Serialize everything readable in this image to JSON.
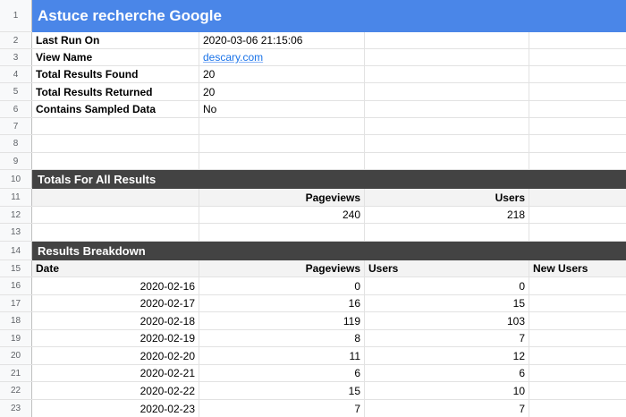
{
  "title": "Astuce recherche Google",
  "row_numbers": [
    "1",
    "2",
    "3",
    "4",
    "5",
    "6",
    "7",
    "8",
    "9",
    "10",
    "11",
    "12",
    "13",
    "14",
    "15",
    "16",
    "17",
    "18",
    "19",
    "20",
    "21",
    "22",
    "23"
  ],
  "meta": [
    {
      "label": "Last Run On",
      "value": "2020-03-06 21:15:06"
    },
    {
      "label": "View Name",
      "value": "descary.com"
    },
    {
      "label": "Total Results Found",
      "value": "20"
    },
    {
      "label": "Total Results Returned",
      "value": "20"
    },
    {
      "label": "Contains Sampled Data",
      "value": "No"
    }
  ],
  "totals": {
    "heading": "Totals For All Results",
    "col_pageviews": "Pageviews",
    "col_users": "Users",
    "pageviews": "240",
    "users": "218"
  },
  "breakdown": {
    "heading": "Results Breakdown",
    "headers": {
      "date": "Date",
      "pageviews": "Pageviews",
      "users": "Users",
      "new_users": "New Users"
    },
    "rows": [
      {
        "date": "2020-02-16",
        "pageviews": "0",
        "users": "0"
      },
      {
        "date": "2020-02-17",
        "pageviews": "16",
        "users": "15"
      },
      {
        "date": "2020-02-18",
        "pageviews": "119",
        "users": "103"
      },
      {
        "date": "2020-02-19",
        "pageviews": "8",
        "users": "7"
      },
      {
        "date": "2020-02-20",
        "pageviews": "11",
        "users": "12"
      },
      {
        "date": "2020-02-21",
        "pageviews": "6",
        "users": "6"
      },
      {
        "date": "2020-02-22",
        "pageviews": "15",
        "users": "10"
      },
      {
        "date": "2020-02-23",
        "pageviews": "7",
        "users": "7"
      }
    ]
  },
  "colors": {
    "title_bar": "#4a86e8",
    "section_bar": "#434343",
    "link": "#1a73e8"
  }
}
